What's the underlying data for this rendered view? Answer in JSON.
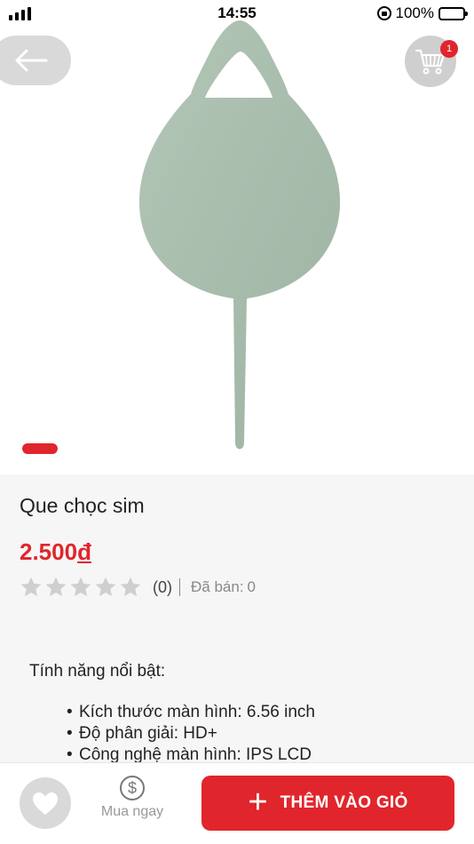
{
  "status_bar": {
    "time": "14:55",
    "battery": "100%",
    "signal_icon": "cellular-signal-icon",
    "rotation_icon": "orientation-lock-icon",
    "battery_icon": "battery-charging-icon"
  },
  "header": {
    "back_icon": "arrow-left-icon",
    "cart_icon": "shopping-cart-icon",
    "cart_count": "1"
  },
  "gallery": {
    "image_icon": "sim-ejector-pin-image",
    "active_page": 1
  },
  "product": {
    "name": "Que chọc sim",
    "price": "2.500",
    "currency": "đ",
    "rating_count": "(0)",
    "rating_stars": 0,
    "rating_max": 5,
    "sold_label": "Đã bán:",
    "sold_count": "0"
  },
  "description": {
    "heading": "Tính năng nổi bật:",
    "features": [
      "Kích thước màn hình: 6.56 inch",
      "Độ phân giải: HD+",
      "Công nghệ màn hình: IPS LCD"
    ]
  },
  "bottom_bar": {
    "favorite_icon": "heart-icon",
    "buy_now_icon": "dollar-icon",
    "buy_now_label": "Mua ngay",
    "add_to_cart_icon": "plus-icon",
    "add_to_cart_label": "THÊM VÀO GIỎ"
  },
  "colors": {
    "accent": "#e0262c",
    "product_green": "#a9bfae",
    "star_empty": "#cfcfcf"
  }
}
